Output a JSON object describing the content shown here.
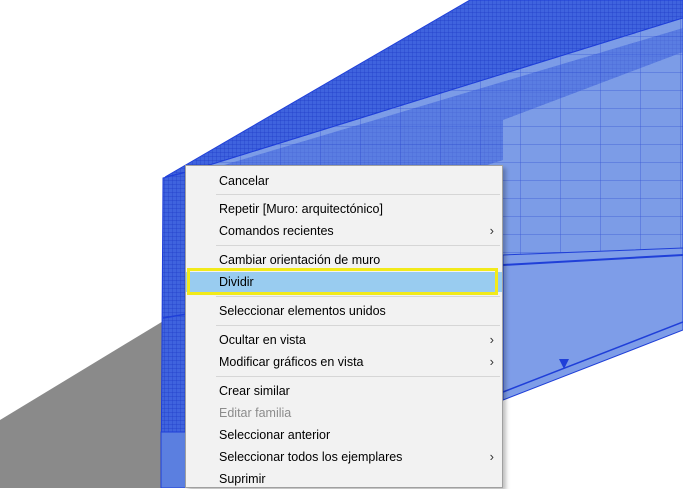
{
  "context_menu": {
    "items": [
      {
        "label": "Cancelar",
        "submenu": false,
        "disabled": false
      },
      {
        "label": "Repetir [Muro: arquitectónico]",
        "submenu": false,
        "disabled": false
      },
      {
        "label": "Comandos recientes",
        "submenu": true,
        "disabled": false
      },
      {
        "label": "Cambiar orientación de muro",
        "submenu": false,
        "disabled": false
      },
      {
        "label": "Dividir",
        "submenu": false,
        "disabled": false,
        "highlighted": true
      },
      {
        "label": "Seleccionar elementos unidos",
        "submenu": false,
        "disabled": false
      },
      {
        "label": "Ocultar en vista",
        "submenu": true,
        "disabled": false
      },
      {
        "label": "Modificar gráficos en vista",
        "submenu": true,
        "disabled": false
      },
      {
        "label": "Crear similar",
        "submenu": false,
        "disabled": false
      },
      {
        "label": "Editar familia",
        "submenu": false,
        "disabled": true
      },
      {
        "label": "Seleccionar anterior",
        "submenu": false,
        "disabled": false
      },
      {
        "label": "Seleccionar todos los ejemplares",
        "submenu": true,
        "disabled": false
      },
      {
        "label": "Suprimir",
        "submenu": false,
        "disabled": false
      }
    ],
    "submenu_glyph": "›"
  },
  "colors": {
    "wall_selected": "#7b9be6",
    "wall_edge": "#1f3fd8",
    "ground": "#8a8a8a",
    "menu_bg": "#f2f2f2",
    "highlight": "#99ccf0",
    "callout": "#f2ea1a"
  }
}
